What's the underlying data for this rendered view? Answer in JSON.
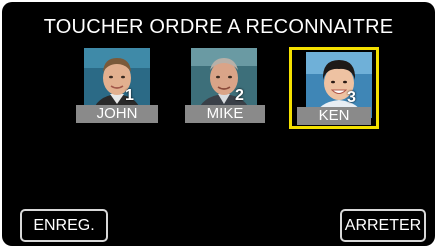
{
  "title": "TOUCHER ORDRE A RECONNAITRE",
  "faces": [
    {
      "name": "JOHN",
      "number": "1",
      "selected": false
    },
    {
      "name": "MIKE",
      "number": "2",
      "selected": false
    },
    {
      "name": "KEN",
      "number": "3",
      "selected": true
    }
  ],
  "buttons": {
    "save": "ENREG.",
    "stop": "ARRETER"
  },
  "colors": {
    "background": "#000000",
    "selection": "#f4e000",
    "name_plate": "#8a8a8a",
    "text": "#ffffff"
  }
}
